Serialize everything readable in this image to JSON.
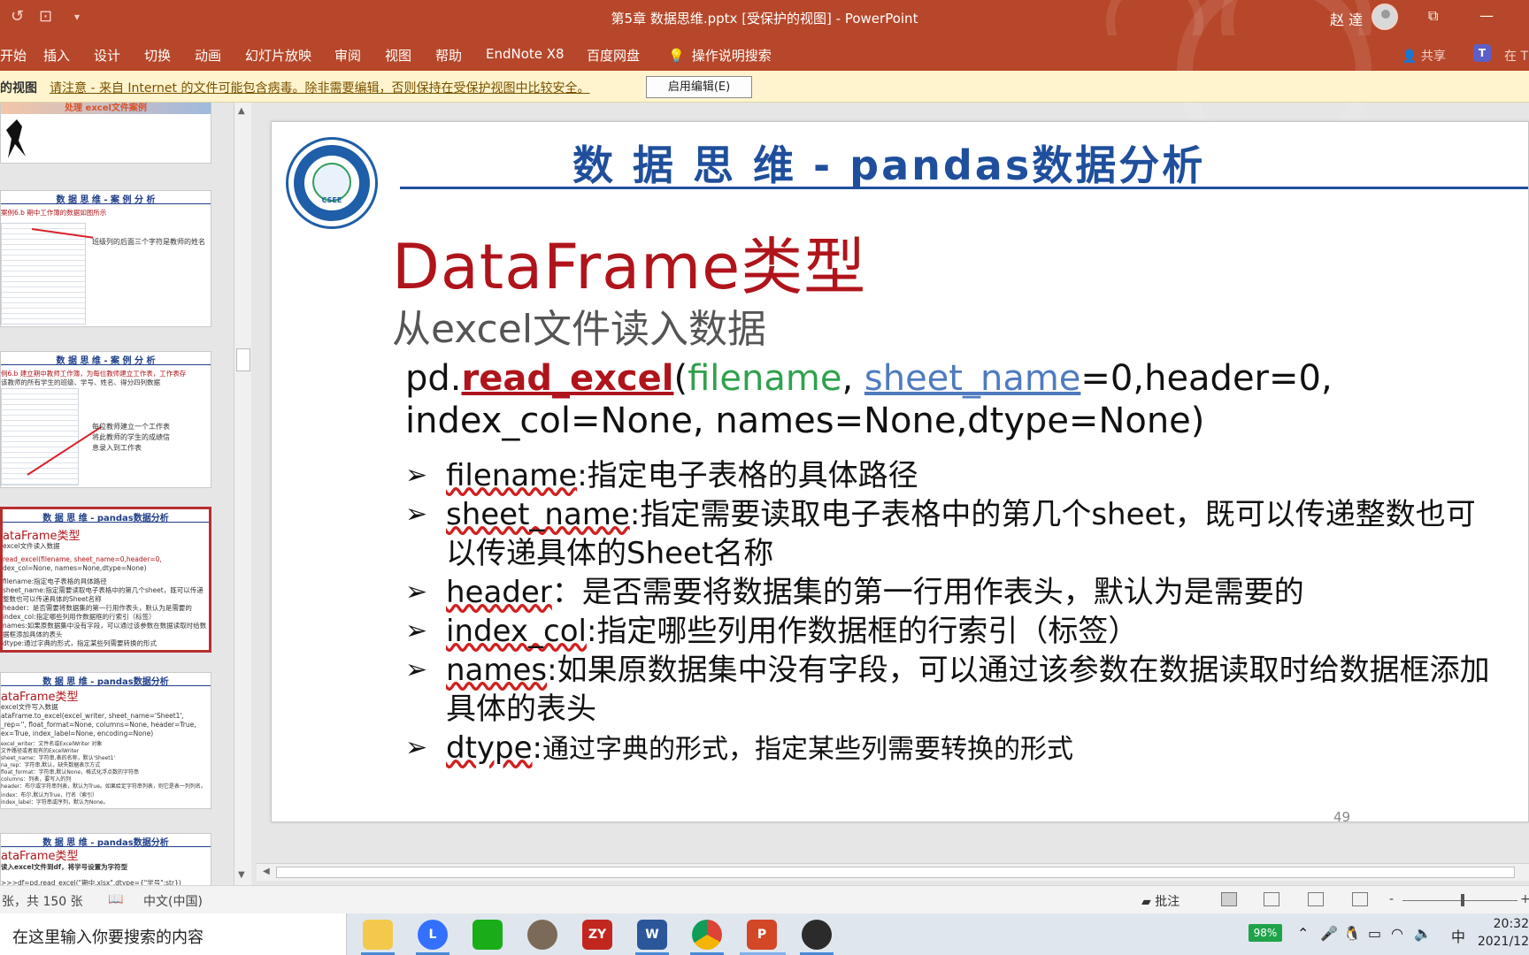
{
  "titlebar": {
    "doc_title": "第5章 数据思维.pptx [受保护的视图] - PowerPoint",
    "user_name": "赵 達",
    "undo_icon": "↺",
    "present_icon": "⊡",
    "customize_icon": "▾",
    "restore_icon": "⧉",
    "minimize_icon": "—"
  },
  "ribbon": {
    "tabs": [
      "开始",
      "插入",
      "设计",
      "切换",
      "动画",
      "幻灯片放映",
      "审阅",
      "视图",
      "帮助",
      "EndNote X8",
      "百度网盘"
    ],
    "tell_me": "操作说明搜索",
    "share": "共享",
    "teams_letter": "T",
    "teams_label": "在 T"
  },
  "protected_view": {
    "label": "的视图",
    "message": "请注意 - 来自 Internet 的文件可能包含病毒。除非需要编辑，否则保持在受保护视图中比较安全。",
    "enable_button": "启用编辑(E)"
  },
  "thumbnails": [
    {
      "title": "处理 excel文件案例"
    },
    {
      "title": "数 据 思 维 - 案 例 分 析",
      "line1": "案例6.b 期中工作簿的数据如图所示",
      "note": "班级列的后面三个字符是教师的姓名"
    },
    {
      "title": "数 据 思 维 - 案 例 分 析",
      "line1": "例6.b 建立期中教师工作簿，为每位教师建立工作表，工作表存",
      "line2": "该教师的所有学生的班级、学号、姓名、得分四列数据",
      "note1": "每位教师建立一个工作表",
      "note2": "将此教师的学生的成绩信",
      "note3": "息录入到工作表"
    },
    {
      "title": "数 据 思 维 - pandas数据分析",
      "sub": "ataFrame类型",
      "lines": [
        "excel文件读入数据",
        "read_excel(filename, sheet_name=0,header=0,",
        "dex_col=None, names=None,dtype=None)",
        "filename:指定电子表格的具体路径",
        "sheet_name:指定需要读取电子表格中的第几个sheet，既可以传递",
        "整数也可以传递具体的Sheet名称",
        "header：是否需要将数据集的第一行用作表头，默认为是需要的",
        "index_col:指定哪些列用作数据框的行索引（标签）",
        "names:如果原数据集中没有字段，可以通过该参数在数据读取时给数",
        "据框添加具体的表头",
        "dtype:通过字典的形式，指定某些列需要转换的形式"
      ]
    },
    {
      "title": "数 据 思 维 - pandas数据分析",
      "sub": "ataFrame类型",
      "lines": [
        "excel文件写入数据",
        "ataFrame.to_excel(excel_writer, sheet_name='Sheet1',",
        "_rep='', float_format=None, columns=None, header=True,",
        "ex=True, index_label=None, encoding=None)",
        "excel_writer：文件名或ExcelWriter 对象",
        "文件路径或者现有的ExcelWriter",
        "sheet_name：字符串,表的名称，默认'Sheet1'",
        "na_rep：字符串,默认，缺失数据表示方式",
        "float_format：字符串,默认None，格式化浮点数的字符串",
        "columns：列表，要写入的列",
        "header：布尔或字符串列表，默认为True。如果给定字符串列表，则它是表一列列名。",
        "index：布尔,默认为True，行名（索引）",
        "index_label：字符串或序列，默认为None。"
      ]
    },
    {
      "title": "数 据 思 维 - pandas数据分析",
      "sub": "ataFrame类型",
      "lines": [
        "读入excel文件到df，将学号设置为字符型",
        ">>>df=pd.read_excel(\"期中.xlsx\",dtype={\"学号\":str})"
      ]
    }
  ],
  "slide": {
    "logo_text": "CSEE",
    "header": "数 据 思 维 -  pandas数据分析",
    "title": "DataFrame类型",
    "subtitle": "从excel文件读入数据",
    "code": {
      "prefix": "pd.",
      "fn": "read_excel",
      "open": "(",
      "arg1": "filename",
      "sep1": ", ",
      "arg2": "sheet_name",
      "rest1": "=0,header=0,",
      "line2": "index_col=None, names=None,dtype=None)"
    },
    "bullet_marker": "➢",
    "bullets": [
      {
        "key": "filename",
        "sep": ":",
        "text": "指定电子表格的具体路径"
      },
      {
        "key": "sheet_name",
        "sep": ":",
        "text": "指定需要读取电子表格中的第几个sheet，既可以传递整数也可以传递具体的Sheet名称"
      },
      {
        "key": "header",
        "sep": "：",
        "text": "是否需要将数据集的第一行用作表头，默认为是需要的"
      },
      {
        "key": "index_col",
        "sep": ":",
        "text": "指定哪些列用作数据框的行索引（标签）"
      },
      {
        "key": "names",
        "sep": ":",
        "text": "如果原数据集中没有字段，可以通过该参数在数据读取时给数据框添加具体的表头"
      },
      {
        "key": "dtype",
        "sep": ":",
        "text": "通过字典的形式，指定某些列需要转换的形式"
      }
    ],
    "page_number": "49"
  },
  "statusbar": {
    "slide_count": "张，共 150 张",
    "language": "中文(中国)",
    "notes": "批注",
    "zoom_minus": "-",
    "zoom_plus": "+"
  },
  "taskbar": {
    "search_placeholder": "在这里输入你要搜索的内容",
    "apps": [
      "file-explorer",
      "lark",
      "wechat",
      "photo",
      "ZY",
      "W",
      "chrome",
      "P",
      "obs"
    ],
    "battery": "98%",
    "ime": "中",
    "time": "20:32",
    "date": "2021/12"
  }
}
